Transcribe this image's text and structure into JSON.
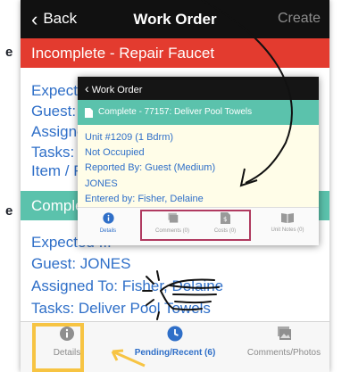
{
  "background_labels": {
    "left_e": "e",
    "left_e_bottom": "e"
  },
  "navbar": {
    "back_label": "Back",
    "title": "Work Order",
    "create_label": "Create"
  },
  "header_incomplete": "Incomplete - Repair Faucet",
  "incomplete_details": [
    "Expect",
    "Guest:",
    "Assigne",
    "Tasks:",
    "Item / F"
  ],
  "header_complete": "Comple",
  "complete_details": [
    "Expected ...",
    "Guest: JONES",
    "Assigned To: Fisher, Delaine",
    "Tasks: Deliver Pool Towels"
  ],
  "popup": {
    "nav_back_label": "Work Order",
    "header": "Complete - 77157: Deliver Pool Towels",
    "lines": [
      "Unit #1209 (1 Bdrm)",
      "Not Occupied",
      "Reported By: Guest  (Medium)",
      "JONES",
      "Entered by: Fisher, Delaine"
    ],
    "tabs": [
      "Details",
      "Comments (0)",
      "Costs (0)",
      "Unit Notes (0)"
    ]
  },
  "tabbar": {
    "tabs": [
      {
        "label": "Details",
        "icon": "info-icon"
      },
      {
        "label": "Pending/Recent (6)",
        "icon": "clock-icon"
      },
      {
        "label": "Comments/Photos",
        "icon": "photo-icon"
      }
    ]
  },
  "colors": {
    "accent_red": "#e33b2f",
    "accent_teal": "#5bc2ac",
    "link_blue": "#2f6fc8",
    "highlight_yellow": "#f7c443"
  }
}
